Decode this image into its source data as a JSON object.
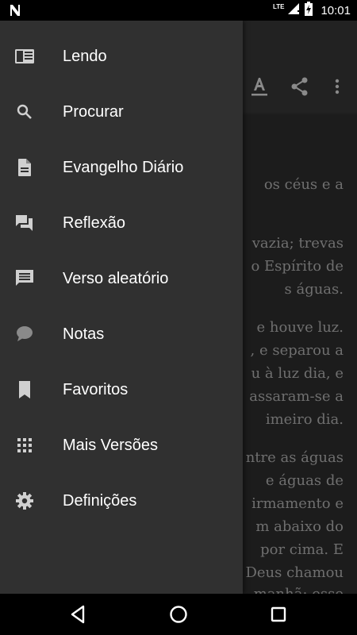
{
  "status_bar": {
    "network_label": "LTE",
    "time": "10:01"
  },
  "reading": {
    "lines": [
      "os céus e a",
      "vazia; trevas",
      "o Espírito de",
      "s águas.",
      "e houve luz.",
      ", e separou a",
      "u à luz dia, e",
      "assaram-se a",
      "imeiro dia.",
      "ntre as águas",
      "e águas de",
      "irmamento e",
      "m abaixo do",
      "por cima. E",
      "Deus chamou",
      "manhã; esse"
    ]
  },
  "drawer": {
    "items": [
      {
        "label": "Lendo",
        "icon": "book-reading-icon"
      },
      {
        "label": "Procurar",
        "icon": "search-icon"
      },
      {
        "label": "Evangelho Diário",
        "icon": "document-icon"
      },
      {
        "label": "Reflexão",
        "icon": "forum-icon"
      },
      {
        "label": "Verso aleatório",
        "icon": "chat-list-icon"
      },
      {
        "label": "Notas",
        "icon": "speech-bubble-icon"
      },
      {
        "label": "Favoritos",
        "icon": "bookmark-icon"
      },
      {
        "label": "Mais Versões",
        "icon": "grid-icon"
      },
      {
        "label": "Definições",
        "icon": "gear-icon"
      }
    ]
  },
  "colors": {
    "drawer_bg": "#303030",
    "page_bg": "#1c1c1c",
    "text": "#ffffff",
    "icon": "#d0d0d0"
  }
}
